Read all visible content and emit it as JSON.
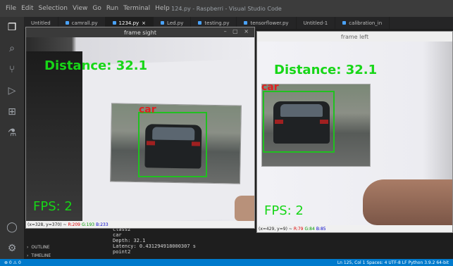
{
  "titlebar": {
    "menu": [
      "File",
      "Edit",
      "Selection",
      "View",
      "Go",
      "Run",
      "Terminal",
      "Help"
    ],
    "window_title": "124.py - Raspberri - Visual Studio Code"
  },
  "tabs": [
    "Untitled",
    "camrall.py",
    "1234.py",
    "Led.py",
    "testing.py",
    "tensorflower.py",
    "Untitled-1",
    "calibration_in"
  ],
  "frame_sight": {
    "title": "frame sight",
    "distance_text": "Distance: 32.1",
    "label": "car",
    "fps_text": "FPS: 2",
    "info_coords": "(x=328, y=370) ~",
    "info_r": "R:209",
    "info_g": "G:193",
    "info_b": "B:233"
  },
  "frame_left": {
    "title": "frame left",
    "distance_text": "Distance: 32.1",
    "label": "car",
    "fps_text": "FPS: 2",
    "info_coords": "(x=429, y=9) ~",
    "info_r": "R:79",
    "info_g": "G:84",
    "info_b": "B:85"
  },
  "terminal": [
    "class2",
    "car",
    "Depth:  32.1",
    "Latency:  0.431294918000307 s",
    "point2"
  ],
  "sidebar": {
    "outline": "OUTLINE",
    "timeline": "TIMELINE"
  },
  "statusbar": {
    "left": "⊗ 0 ⚠ 0",
    "right": "Ln 125, Col 1   Spaces: 4   UTF-8   LF   Python   3.9.2 64-bit"
  }
}
